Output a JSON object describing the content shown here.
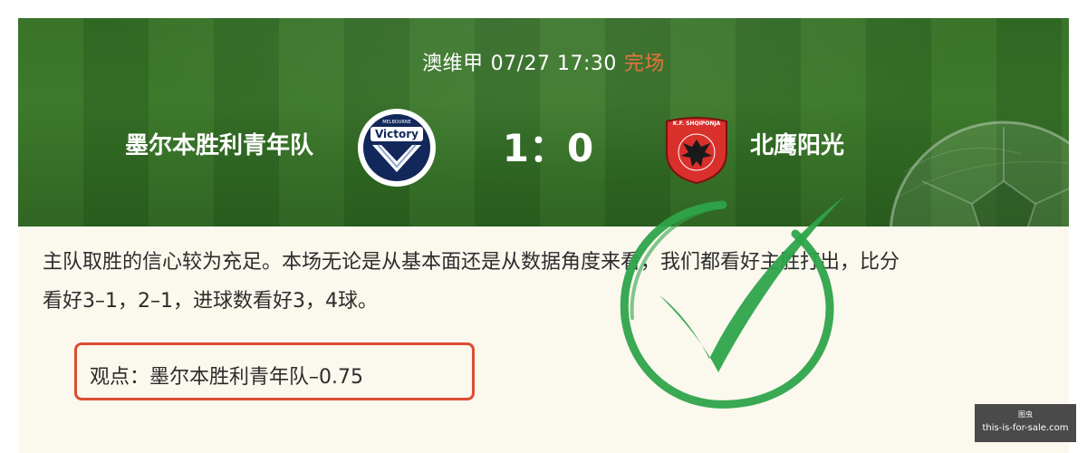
{
  "match": {
    "league": "澳维甲",
    "datetime": "07/27 17:30",
    "status": "完场",
    "home_team": "墨尔本胜利青年队",
    "away_team": "北鹰阳光",
    "score": "1：0",
    "home_logo_text": "MELBOURNE",
    "home_logo_word": "Victory",
    "away_logo_text": "K.F. SHQIPONJA"
  },
  "analysis": {
    "line1": "主队取胜的信心较为充足。本场无论是从基本面还是从数据角度来看，我们都看好主胜打出，比分",
    "line2": "看好3–1，2–1，进球数看好3，4球。",
    "opinion": "观点：墨尔本胜利青年队–0.75"
  },
  "watermark": {
    "line1": "图虫",
    "line2": "this-is-for-sale.com"
  },
  "colors": {
    "status_orange": "#e8743c",
    "opinion_border": "#dd4d32",
    "check_green": "#2ea44a",
    "pitch_green": "#3d7a2c"
  },
  "icons": [
    "victory-crest-icon",
    "shqiponja-crest-icon",
    "football-icon",
    "check-stamp-icon"
  ]
}
